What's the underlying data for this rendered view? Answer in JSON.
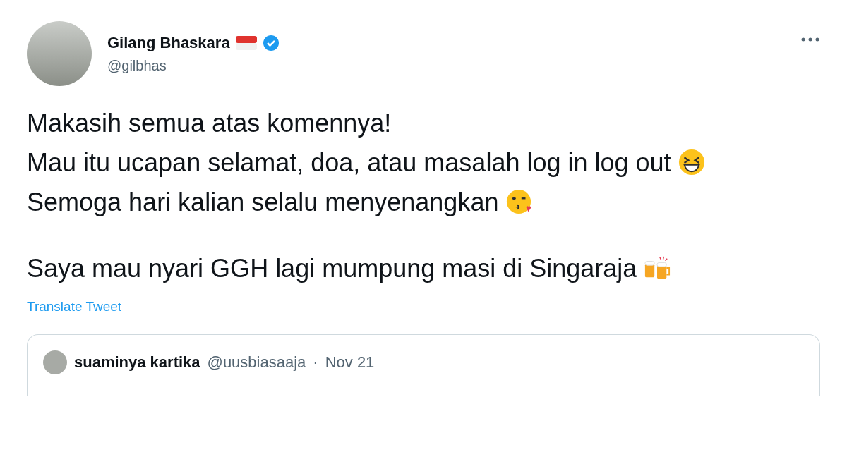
{
  "author": {
    "name": "Gilang Bhaskara",
    "handle": "@gilbhas"
  },
  "paragraphs": [
    [
      {
        "text": "Makasih semua atas komennya!"
      },
      {
        "text": "Mau itu ucapan selamat, doa, atau masalah log in log out",
        "kind": "laughing"
      },
      {
        "text": "Semoga hari kalian selalu menyenangkan",
        "kind": "kiss"
      }
    ],
    [
      {
        "text": "Saya mau nyari GGH lagi mumpung masi di Singaraja",
        "kind": "beers"
      }
    ]
  ],
  "translate_link": "Translate Tweet",
  "quoted": {
    "name": "suaminya kartika",
    "handle": "@uusbiasaaja",
    "separator": "·",
    "date": "Nov 21"
  }
}
